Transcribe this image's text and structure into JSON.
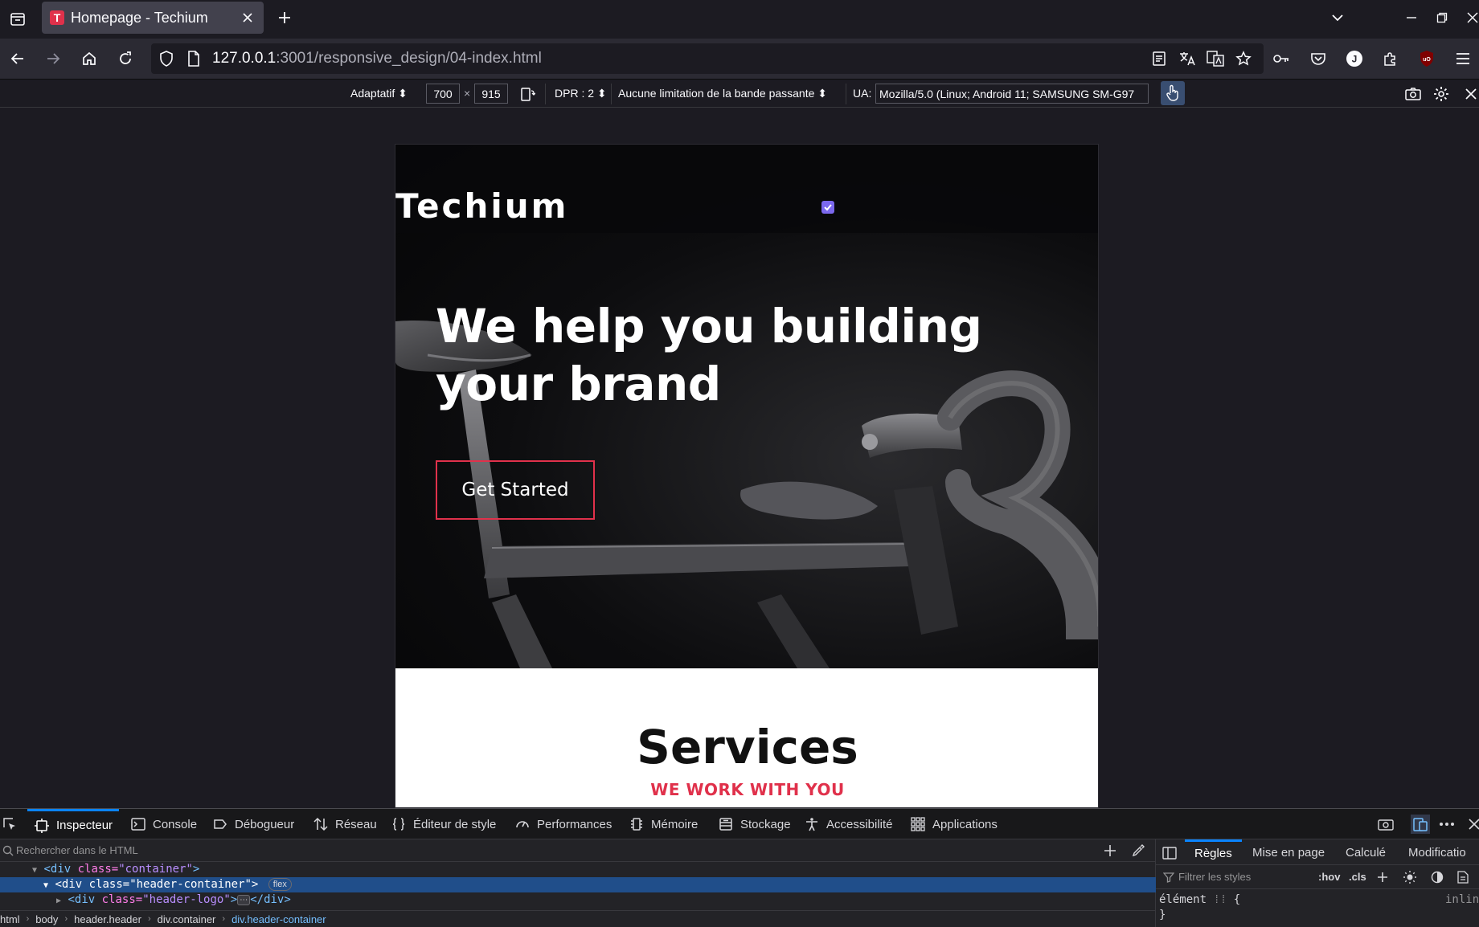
{
  "browser": {
    "tab_title": "Homepage - Techium",
    "tab_favicon_letter": "T",
    "url_host": "127.0.0.1",
    "url_rest": ":3001/responsive_design/04-index.html"
  },
  "rdm": {
    "device": "Adaptatif",
    "width": "700",
    "times": "×",
    "height": "915",
    "dpr": "DPR : 2",
    "throttling": "Aucune limitation de la bande passante",
    "ua_label": "UA:",
    "ua_value": "Mozilla/5.0 (Linux; Android 11; SAMSUNG SM-G97"
  },
  "page": {
    "logo": "Techium",
    "headline": "We help you building your brand",
    "cta_label": "Get Started",
    "services_title": "Services",
    "services_subtitle": "WE WORK WITH YOU",
    "accent_color": "#e0314b"
  },
  "devtools": {
    "tabs": [
      "Inspecteur",
      "Console",
      "Débogueur",
      "Réseau",
      "Éditeur de style",
      "Performances",
      "Mémoire",
      "Stockage",
      "Accessibilité",
      "Applications"
    ],
    "search_placeholder": "Rechercher dans le HTML",
    "markup": {
      "line1_tag": "<div",
      "line1_attr": "class=",
      "line1_val": "\"container\"",
      "line1_end": ">",
      "line2_tag": "<div",
      "line2_attr": "class=",
      "line2_val": "\"header-container\"",
      "line2_end": ">",
      "line2_badge": "flex",
      "line3_tag": "<div",
      "line3_attr": "class=",
      "line3_val": "\"header-logo\"",
      "line3_end": ">",
      "line3_ellipsis": "⋯",
      "line3_close": "</div>"
    },
    "breadcrumbs": [
      "html",
      "body",
      "header.header",
      "div.container",
      "div.header-container"
    ],
    "sidebar_tabs": [
      "Règles",
      "Mise en page",
      "Calculé",
      "Modificatio"
    ],
    "filter_placeholder": "Filtrer les styles",
    "hov": ":hov",
    "cls": ".cls",
    "rule_selector": "élément",
    "rule_open": "{",
    "rule_close": "}",
    "rule_inline": "inline"
  }
}
